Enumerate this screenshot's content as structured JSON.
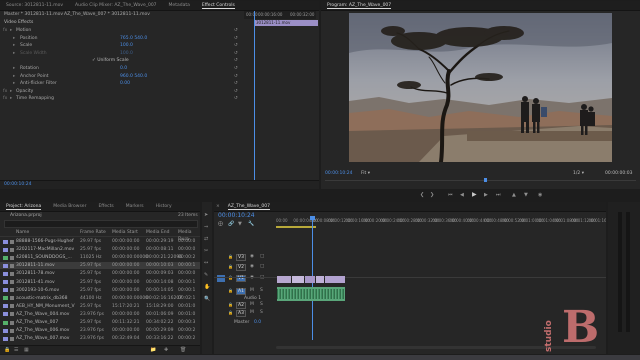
{
  "source_panel": {
    "tabs": [
      "Source: 3012811-11.mov",
      "Audio Clip Mixer: AZ_The_Wave_007",
      "Metadata",
      "Effect Controls"
    ],
    "active_tab": 3,
    "header_source": "Master * 3012811-11.mov",
    "header_seq": "AZ_The_Wave_007 * 3012811-11.mov",
    "clip_label": "3012811-11.mov",
    "ruler": [
      "00:00",
      "00:00:16:00",
      "00:00:32:00"
    ],
    "section_video": "Video Effects",
    "effects": [
      {
        "name": "Motion",
        "value": "",
        "indent": 1
      },
      {
        "name": "Position",
        "value": "765.0   540.0",
        "indent": 2
      },
      {
        "name": "Scale",
        "value": "100.0",
        "indent": 2
      },
      {
        "name": "Scale Width",
        "value": "100.0",
        "indent": 2,
        "dim": true
      },
      {
        "name": "",
        "value": "✓ Uniform Scale",
        "indent": 3
      },
      {
        "name": "Rotation",
        "value": "0.0",
        "indent": 2
      },
      {
        "name": "Anchor Point",
        "value": "960.0   540.0",
        "indent": 2
      },
      {
        "name": "Anti-flicker Filter",
        "value": "0.00",
        "indent": 2
      },
      {
        "name": "Opacity",
        "value": "",
        "indent": 1
      },
      {
        "name": "Time Remapping",
        "value": "",
        "indent": 1
      }
    ],
    "timecode": "00:00:10:24"
  },
  "program_panel": {
    "tab": "Program: AZ_The_Wave_007",
    "timecode": "00:00:10:24",
    "fit": "Fit",
    "resolution": "1/2",
    "duration": "00:00:00:03"
  },
  "project_panel": {
    "tabs": [
      "Project: Arizona",
      "Media Browser",
      "Effects",
      "Markers",
      "History"
    ],
    "project_file": "Arizona.prproj",
    "item_count": "23 Items",
    "columns": [
      "Name",
      "Frame Rate",
      "Media Start",
      "Media End",
      "Media Dura"
    ],
    "items": [
      {
        "name": "88888-1566-Pugs-Hughef",
        "rate": "29.97 fps",
        "start": "00:00:00:00",
        "end": "00:00:29:19",
        "dur": "00:00:0",
        "color": "#8b8fdc"
      },
      {
        "name": "3202117-MacMillan2.mov",
        "rate": "25.97 fps",
        "start": "00:00:00:00",
        "end": "00:00:08:11",
        "dur": "00:00:0",
        "color": "#8b8fdc"
      },
      {
        "name": "420811_SOUNDDOGS_...",
        "rate": "11025 Hz",
        "start": "00:00:00:00000",
        "end": "00:00:21:22096",
        "dur": "00:00:2",
        "color": "#55b06a"
      },
      {
        "name": "3012811-11.mov",
        "rate": "25.97 fps",
        "start": "00:00:00:00",
        "end": "00:00:10:03",
        "dur": "00:00:1",
        "color": "#8b8fdc",
        "selected": true
      },
      {
        "name": "3012811-78.mov",
        "rate": "25.97 fps",
        "start": "00:00:00:00",
        "end": "00:00:09:03",
        "dur": "00:00:0",
        "color": "#8b8fdc"
      },
      {
        "name": "3012811-41.mov",
        "rate": "25.97 fps",
        "start": "00:00:00:00",
        "end": "00:00:14:08",
        "dur": "00:00:1",
        "color": "#8b8fdc"
      },
      {
        "name": "3002193-10-6.mov",
        "rate": "25.97 fps",
        "start": "00:00:00:00",
        "end": "00:00:14:05",
        "dur": "00:00:1",
        "color": "#8b8fdc"
      },
      {
        "name": "acoustic-matrix_db368",
        "rate": "44100 Hz",
        "start": "00:00:00:00000",
        "end": "00:02:16:16207",
        "dur": "00:02:1",
        "color": "#55b06a"
      },
      {
        "name": "AEB_HY_NM_Monument_V",
        "rate": "25.97 fps",
        "start": "15:17:20:21",
        "end": "15:18:29:00",
        "dur": "00:01:0",
        "color": "#8b8fdc"
      },
      {
        "name": "AZ_The_Wave_004.mov",
        "rate": "23.976 fps",
        "start": "00:00:00:00",
        "end": "00:01:06:09",
        "dur": "00:01:0",
        "color": "#8b8fdc"
      },
      {
        "name": "AZ_The_Wave_007",
        "rate": "25.97 fps",
        "start": "00:11:32:21",
        "end": "00:34:02:22",
        "dur": "00:00:3",
        "color": "#55b06a"
      },
      {
        "name": "AZ_The_Wave_006.mov",
        "rate": "23.976 fps",
        "start": "00:00:00:00",
        "end": "00:00:29:09",
        "dur": "00:00:2",
        "color": "#8b8fdc"
      },
      {
        "name": "AZ_The_Wave_007.mov",
        "rate": "23.976 fps",
        "start": "00:32:49:04",
        "end": "00:33:16:22",
        "dur": "00:00:2",
        "color": "#8b8fdc"
      }
    ]
  },
  "timeline_panel": {
    "tab": "AZ_The_Wave_007",
    "timecode": "00:00:10:24",
    "ruler": [
      "00:00",
      "00:00:04:00",
      "00:00:08:00",
      "00:00:12:00",
      "00:00:16:00",
      "00:00:20:00",
      "00:00:24:00",
      "00:00:28:00",
      "00:00:32:00",
      "00:00:36:00",
      "00:00:40:00",
      "00:00:44:00",
      "00:00:48:00",
      "00:00:52:00",
      "00:01:00:00",
      "00:01:04:00",
      "00:01:08:00",
      "00:01:12:00",
      "00:01:16:00"
    ],
    "tracks": [
      "V3",
      "V2",
      "V1",
      "A1",
      "A2",
      "A3"
    ],
    "audio_label": "Audio 1",
    "master": "Master",
    "master_value": "0.0"
  },
  "watermark": "studio B"
}
